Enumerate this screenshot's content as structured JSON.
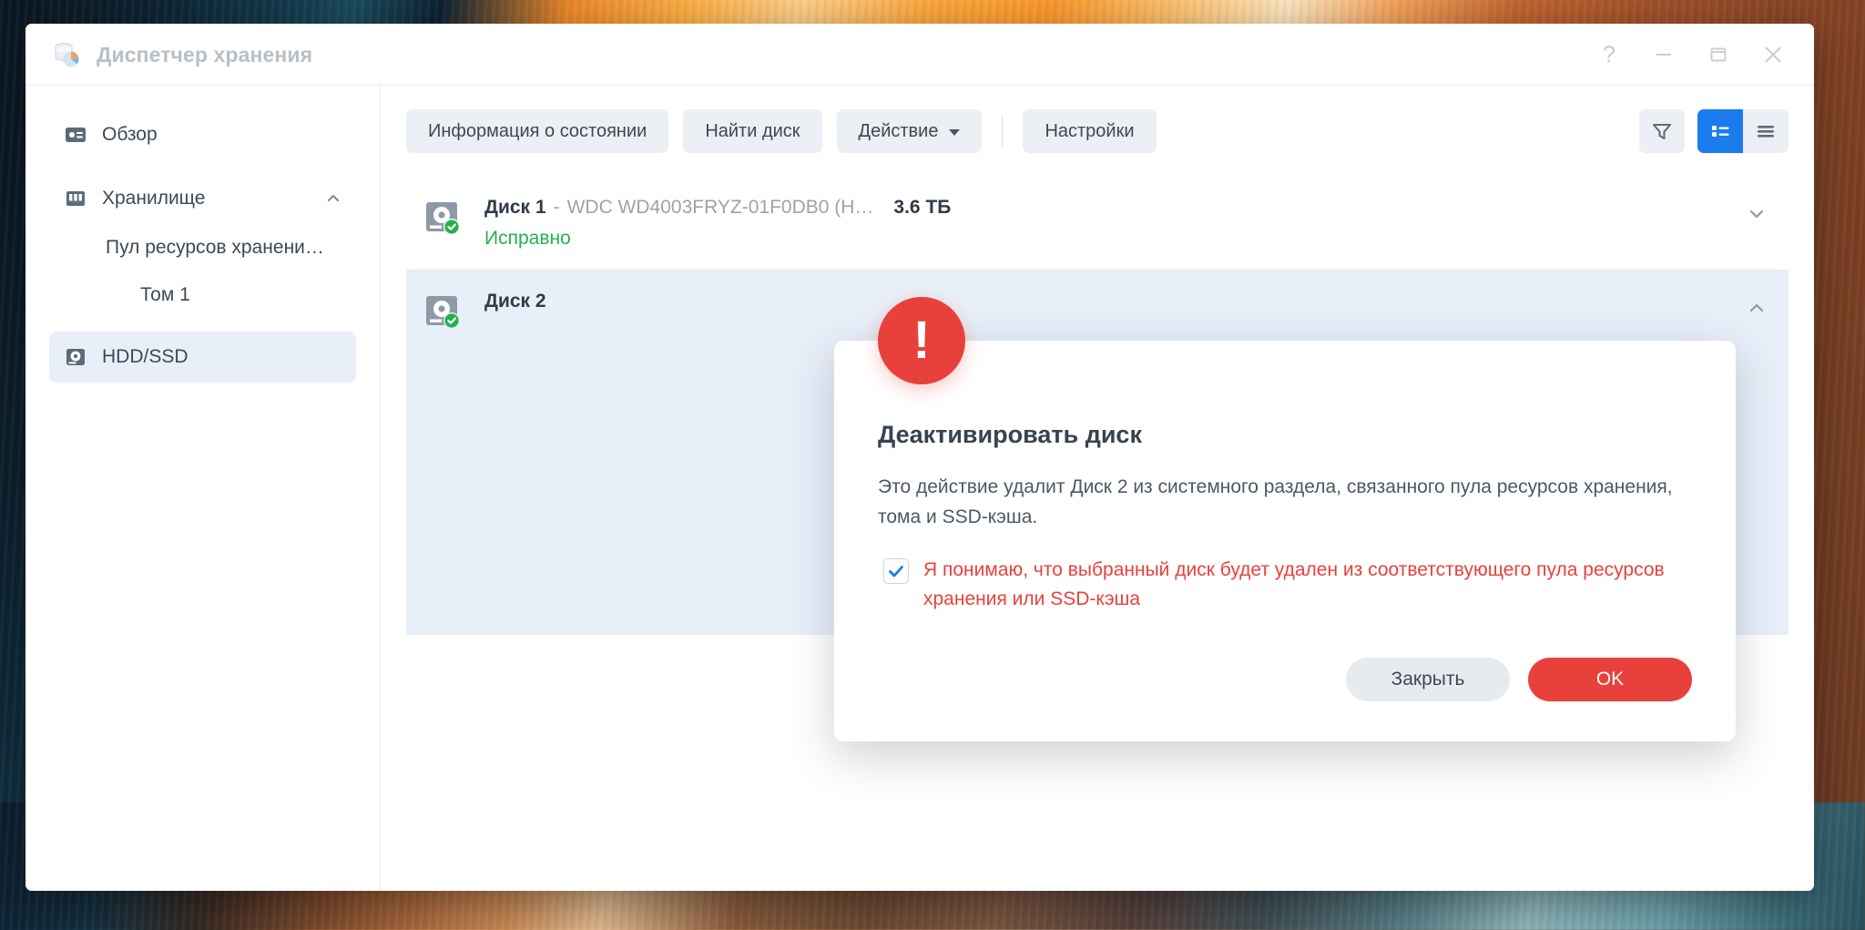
{
  "window": {
    "title": "Диспетчер хранения",
    "app_icon": "storage-database-icon",
    "controls": {
      "help": "?",
      "minimize": "minimize-icon",
      "maximize": "maximize-icon",
      "close": "close-icon"
    }
  },
  "sidebar": {
    "items": [
      {
        "label": "Обзор",
        "icon": "overview-icon",
        "level": 0,
        "selected": false,
        "caret": ""
      },
      {
        "label": "Хранилище",
        "icon": "storage-icon",
        "level": 0,
        "selected": false,
        "caret": "chevron-up-icon"
      },
      {
        "label": "Пул ресурсов хранени…",
        "icon": "",
        "level": 1,
        "selected": false,
        "caret": ""
      },
      {
        "label": "Том 1",
        "icon": "",
        "level": 2,
        "selected": false,
        "caret": ""
      },
      {
        "label": "HDD/SSD",
        "icon": "hdd-icon",
        "level": 0,
        "selected": true,
        "caret": ""
      }
    ]
  },
  "toolbar": {
    "buttons": [
      {
        "label": "Информация о состоянии",
        "dropdown": false
      },
      {
        "label": "Найти диск",
        "dropdown": false
      },
      {
        "label": "Действие",
        "dropdown": true
      },
      {
        "label": "Настройки",
        "dropdown": false
      }
    ],
    "right_icons": [
      {
        "name": "filter-icon",
        "active": false
      },
      {
        "name": "detail-list-view-icon",
        "active": true
      },
      {
        "name": "list-view-icon",
        "active": false
      }
    ]
  },
  "disks": [
    {
      "name": "Диск 1",
      "separator": "-",
      "model": "WDC WD4003FRYZ-01F0DB0 (H…",
      "size": "3.6 ТБ",
      "status": "Исправно",
      "status_color": "#25b14e",
      "caret": "chevron-down-icon",
      "expanded": false
    },
    {
      "name": "Диск 2",
      "separator": "-",
      "model": "",
      "size": "",
      "status": "",
      "status_color": "#25b14e",
      "caret": "chevron-up-icon",
      "expanded": true
    }
  ],
  "dialog": {
    "badge": "!",
    "title": "Деактивировать диск",
    "body": "Это действие удалит Диск 2 из системного раздела, связанного пула ресурсов хранения, тома и SSD-кэша.",
    "checkbox": {
      "checked": true,
      "label": "Я понимаю, что выбранный диск будет удален из соответствующего пула ресурсов хранения или SSD-кэша",
      "color": "#e8413c"
    },
    "buttons": {
      "cancel": "Закрыть",
      "confirm": "OK"
    }
  },
  "colors": {
    "accent_blue": "#1a7ced",
    "danger_red": "#e8413c",
    "ok_green": "#25b14e",
    "selected_row": "#e8eff9",
    "toolbar_btn": "#eceff3"
  }
}
